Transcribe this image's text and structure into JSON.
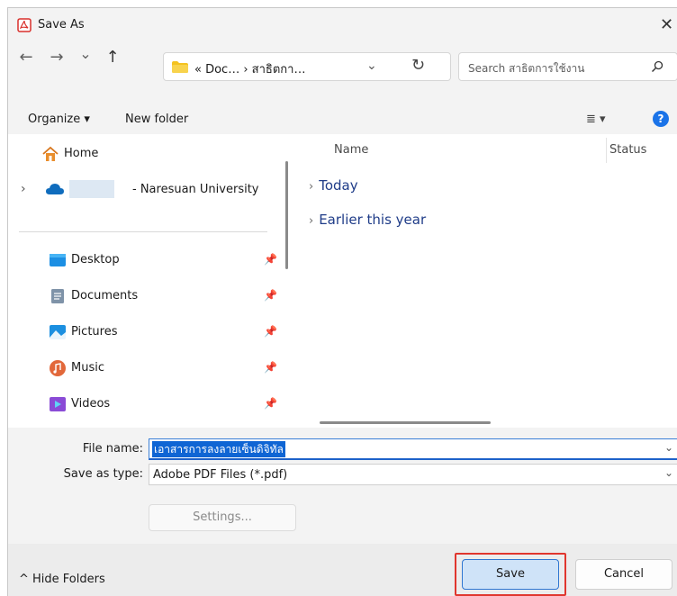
{
  "window": {
    "title": "Save As",
    "close_glyph": "✕"
  },
  "nav": {
    "back_glyph": "←",
    "forward_glyph": "→",
    "recent_glyph": "⌄",
    "up_glyph": "↑",
    "address_path": "« Doc… › สาธิตกา…",
    "address_dropdown_glyph": "⌄",
    "refresh_glyph": "↻",
    "search_placeholder": "Search สาธิตการใช้งาน"
  },
  "toolbar": {
    "organize_label": "Organize ▾",
    "new_folder_label": "New folder",
    "view_glyph": "≣ ▾",
    "help_glyph": "?"
  },
  "sidebar": {
    "home_label": "Home",
    "onedrive_expand_glyph": "›",
    "onedrive_label": "- Naresuan University",
    "items": [
      {
        "label": "Desktop",
        "icon": "desktop-icon",
        "pin": "📌"
      },
      {
        "label": "Documents",
        "icon": "documents-icon",
        "pin": "📌"
      },
      {
        "label": "Pictures",
        "icon": "pictures-icon",
        "pin": "📌"
      },
      {
        "label": "Music",
        "icon": "music-icon",
        "pin": "📌"
      },
      {
        "label": "Videos",
        "icon": "videos-icon",
        "pin": "📌"
      }
    ]
  },
  "filelist": {
    "col_name": "Name",
    "col_status": "Status",
    "groups": [
      {
        "chevron": "›",
        "label": "Today"
      },
      {
        "chevron": "›",
        "label": "Earlier this year"
      }
    ]
  },
  "form": {
    "filename_label": "File name:",
    "filename_value": "เอาสารการลงลายเซ็นดิจิทัล",
    "savetype_label": "Save as type:",
    "savetype_value": "Adobe PDF Files (*.pdf)",
    "dropdown_glyph": "⌄",
    "settings_label": "Settings..."
  },
  "footer": {
    "hide_folders_label": "^ Hide Folders",
    "save_label": "Save",
    "cancel_label": "Cancel"
  },
  "colors": {
    "accent": "#0f65d4",
    "highlight_box": "#e0362e",
    "group_text": "#1f3c88",
    "pdf_icon": "#d9302c"
  }
}
